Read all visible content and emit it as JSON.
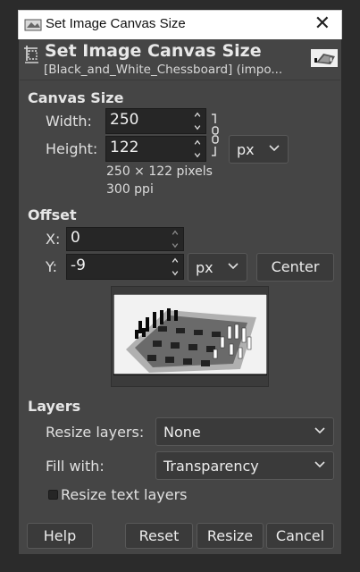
{
  "window": {
    "title": "Set Image Canvas Size",
    "close_glyph": "✕"
  },
  "header": {
    "title": "Set Image Canvas Size",
    "subtitle": "[Black_and_White_Chessboard] (impo...",
    "icon": "canvas-size-icon"
  },
  "canvas_size": {
    "section_label": "Canvas Size",
    "width_label": "Width:",
    "width_value": "250",
    "height_label": "Height:",
    "height_value": "122",
    "unit": "px",
    "pixels_info": "250 × 122 pixels",
    "ppi_info": "300 ppi",
    "chain_icon": "chain-link-icon"
  },
  "offset": {
    "section_label": "Offset",
    "x_label": "X:",
    "x_value": "0",
    "y_label": "Y:",
    "y_value": "-9",
    "unit": "px",
    "center_label": "Center"
  },
  "layers": {
    "section_label": "Layers",
    "resize_label": "Resize layers:",
    "resize_value": "None",
    "fill_label": "Fill with:",
    "fill_value": "Transparency",
    "resize_text_label": "Resize text layers"
  },
  "buttons": {
    "help": "Help",
    "reset": "Reset",
    "resize": "Resize",
    "cancel": "Cancel"
  },
  "colors": {
    "background": "#454545",
    "field": "#262626",
    "text": "#e6e6e6"
  }
}
